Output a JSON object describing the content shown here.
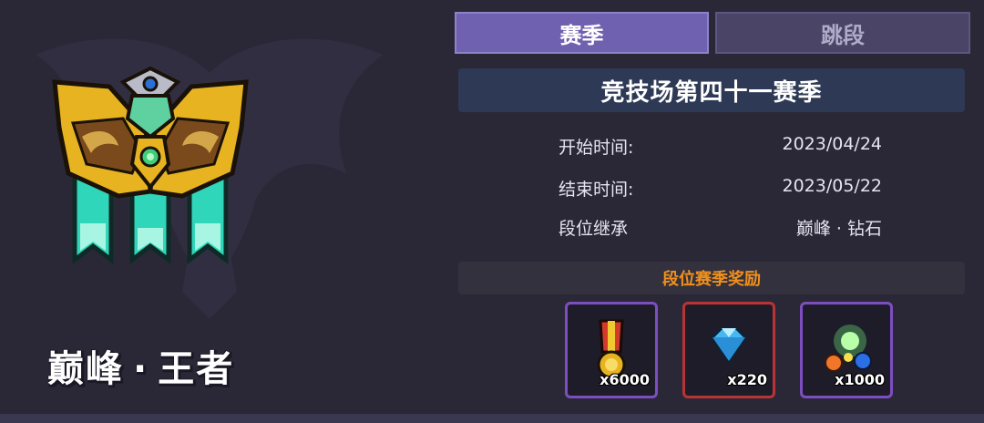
{
  "rank": {
    "name_part1": "巅峰",
    "separator": "·",
    "name_part2": "王者"
  },
  "tabs": [
    {
      "label": "赛季",
      "active": true
    },
    {
      "label": "跳段",
      "active": false
    }
  ],
  "season": {
    "title": "竞技场第四十一赛季",
    "rows": [
      {
        "label": "开始时间:",
        "value": "2023/04/24"
      },
      {
        "label": "结束时间:",
        "value": "2023/05/22"
      },
      {
        "label": "段位继承",
        "value": "巅峰 · 钻石"
      }
    ]
  },
  "rewards": {
    "header": "段位赛季奖励",
    "items": [
      {
        "icon": "medal-icon",
        "count": "x6000",
        "frame_color": "#7d4ec0"
      },
      {
        "icon": "diamond-gem-icon",
        "count": "x220",
        "frame_color": "#b93434"
      },
      {
        "icon": "energy-orbs-icon",
        "count": "x1000",
        "frame_color": "#7d4ec0"
      }
    ]
  },
  "colors": {
    "background": "#2a2836",
    "tab_active": "#6f61b0",
    "tab_inactive": "#4a4566",
    "title_bar": "#2e3a55",
    "reward_header_text": "#f0901c"
  }
}
